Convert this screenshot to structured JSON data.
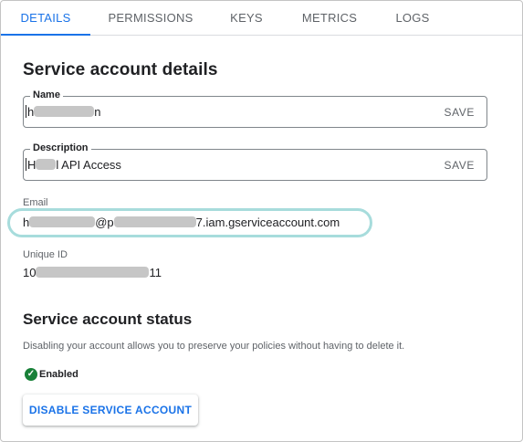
{
  "tabs": [
    {
      "label": "DETAILS",
      "active": true
    },
    {
      "label": "PERMISSIONS",
      "active": false
    },
    {
      "label": "KEYS",
      "active": false
    },
    {
      "label": "METRICS",
      "active": false
    },
    {
      "label": "LOGS",
      "active": false
    }
  ],
  "details": {
    "title": "Service account details",
    "name": {
      "label": "Name",
      "value_start": "h",
      "value_end": "n",
      "save_label": "SAVE"
    },
    "description": {
      "label": "Description",
      "value_start": "H",
      "value_end": "l API Access",
      "save_label": "SAVE"
    },
    "email": {
      "label": "Email",
      "value_part1": "h",
      "value_part2": "@p",
      "value_part3": "7.iam.gserviceaccount.com"
    },
    "unique_id": {
      "label": "Unique ID",
      "value_start": "10",
      "value_end": "11"
    }
  },
  "status_section": {
    "title": "Service account status",
    "description": "Disabling your account allows you to preserve your policies without having to delete it.",
    "status_icon": "check-circle-icon",
    "status_text": "Enabled",
    "status_color": "#188038",
    "disable_label": "DISABLE SERVICE ACCOUNT"
  },
  "colors": {
    "accent": "#1a73e8",
    "highlight": "#a7dcdc",
    "redaction": "#c6c6c6"
  }
}
